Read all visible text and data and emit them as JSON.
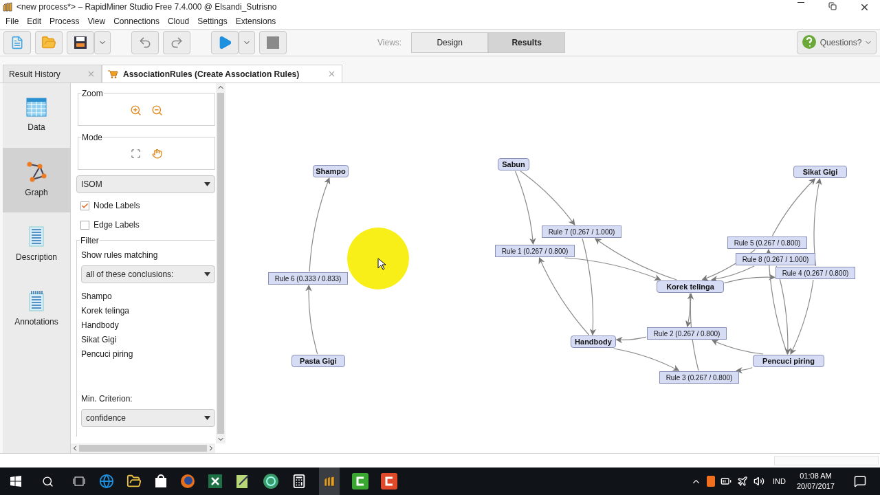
{
  "window": {
    "title": "<new process*> – RapidMiner Studio Free 7.4.000 @ Elsandi_Sutrisno"
  },
  "menu": [
    "File",
    "Edit",
    "Process",
    "View",
    "Connections",
    "Cloud",
    "Settings",
    "Extensions"
  ],
  "views": {
    "label": "Views:",
    "buttons": [
      {
        "label": "Design",
        "selected": false
      },
      {
        "label": "Results",
        "selected": true
      }
    ]
  },
  "help_button": "Questions?",
  "tabs": [
    {
      "label": "Result History",
      "selected": false
    },
    {
      "label": "AssociationRules (Create Association Rules)",
      "selected": true
    }
  ],
  "sidebar": {
    "items": [
      {
        "label": "Data",
        "kind": "table",
        "selected": false
      },
      {
        "label": "Graph",
        "kind": "graph",
        "selected": true
      },
      {
        "label": "Description",
        "kind": "text",
        "selected": false
      },
      {
        "label": "Annotations",
        "kind": "notes",
        "selected": false
      }
    ]
  },
  "panel": {
    "zoom_label": "Zoom",
    "mode_label": "Mode",
    "layout": "ISOM",
    "checkboxes": [
      {
        "label": "Node Labels",
        "checked": true
      },
      {
        "label": "Edge Labels",
        "checked": false
      }
    ],
    "filter": {
      "title": "Filter",
      "label": "Show rules matching",
      "mode": "all of these conclusions:",
      "items": [
        "Shampo",
        "Korek telinga",
        "Handbody",
        "Sikat Gigi",
        "Pencuci piring"
      ],
      "criterion_label": "Min. Criterion:",
      "criterion": "confidence"
    }
  },
  "graph": {
    "nodes": [
      {
        "label": "Sabun",
        "kind": "item"
      },
      {
        "label": "Shampo",
        "kind": "item"
      },
      {
        "label": "Sikat Gigi",
        "kind": "item"
      },
      {
        "label": "Rule 7 (0.267 / 1.000)",
        "kind": "rule"
      },
      {
        "label": "Rule 1 (0.267 / 0.800)",
        "kind": "rule"
      },
      {
        "label": "Rule 5 (0.267 / 0.800)",
        "kind": "rule"
      },
      {
        "label": "Rule 8 (0.267 / 1.000)",
        "kind": "rule"
      },
      {
        "label": "Rule 4 (0.267 / 0.800)",
        "kind": "rule"
      },
      {
        "label": "Rule 6 (0.333 / 0.833)",
        "kind": "rule"
      },
      {
        "label": "Korek telinga",
        "kind": "item"
      },
      {
        "label": "Rule 2 (0.267 / 0.800)",
        "kind": "rule"
      },
      {
        "label": "Handbody",
        "kind": "item"
      },
      {
        "label": "Pasta Gigi",
        "kind": "item"
      },
      {
        "label": "Pencuci piring",
        "kind": "item"
      },
      {
        "label": "Rule 3 (0.267 / 0.800)",
        "kind": "rule"
      }
    ]
  },
  "taskbar": {
    "language": "IND",
    "time": "01:08 AM",
    "date": "20/07/2017"
  }
}
